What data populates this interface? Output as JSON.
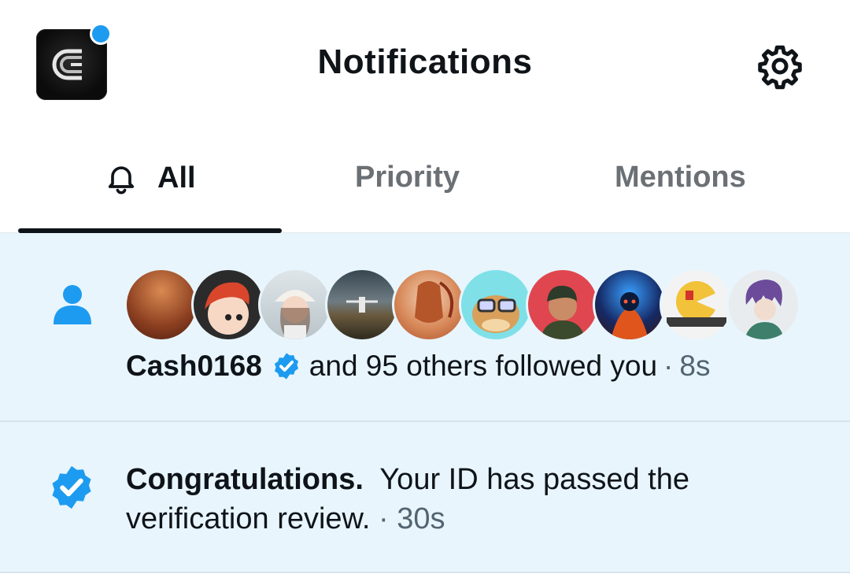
{
  "header": {
    "title": "Notifications",
    "app_icon": "cryptocurrency-c-logo-icon",
    "settings_icon": "gear-icon",
    "unread_dot_color": "#1d9bf0"
  },
  "tabs": [
    {
      "label": "All",
      "icon": "bell-icon",
      "active": true
    },
    {
      "label": "Priority",
      "active": false
    },
    {
      "label": "Mentions",
      "active": false
    }
  ],
  "notifications": [
    {
      "type": "follow",
      "icon": "person-icon",
      "avatars_count": 10,
      "user": "Cash0168",
      "verified": true,
      "text": "and 95 others followed you",
      "separator": "·",
      "time": "8s"
    },
    {
      "type": "verification",
      "icon": "verified-badge-icon",
      "headline": "Congratulations.",
      "text": "Your ID has passed the verification review.",
      "separator": "·",
      "time": "30s"
    }
  ],
  "colors": {
    "accent": "#1d9bf0",
    "highlight_bg": "#e8f5fd",
    "muted_text": "#536471"
  }
}
